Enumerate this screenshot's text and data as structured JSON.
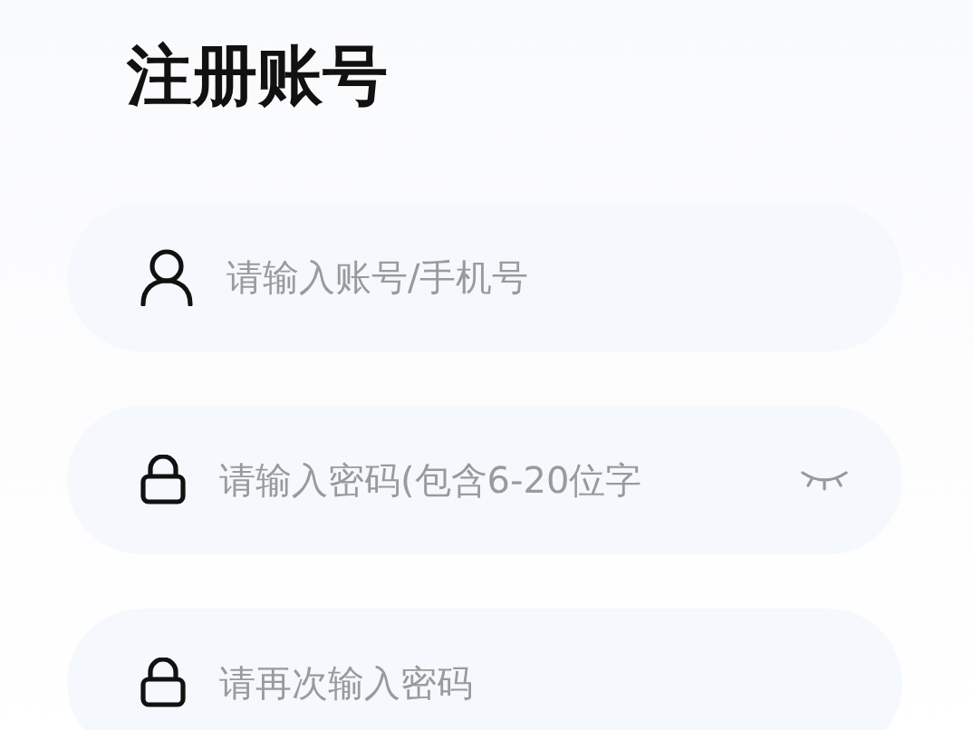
{
  "title": "注册账号",
  "fields": [
    {
      "kind": "user",
      "placeholder": "请输入账号/手机号",
      "show_toggle": false
    },
    {
      "kind": "lock",
      "placeholder": "请输入密码(包含6-20位字",
      "show_toggle": true
    },
    {
      "kind": "lock",
      "placeholder": "请再次输入密码",
      "show_toggle": false
    }
  ]
}
